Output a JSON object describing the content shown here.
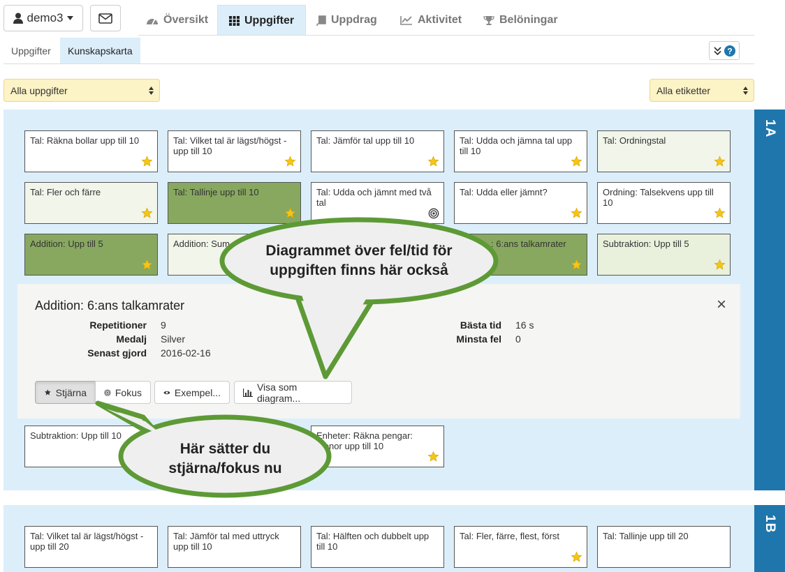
{
  "nav": {
    "user_label": "demo3",
    "tabs": [
      {
        "label": "Översikt",
        "icon": "dashboard-icon"
      },
      {
        "label": "Uppgifter",
        "icon": "grid-icon"
      },
      {
        "label": "Uppdrag",
        "icon": "book-icon"
      },
      {
        "label": "Aktivitet",
        "icon": "line-chart-icon"
      },
      {
        "label": "Belöningar",
        "icon": "trophy-icon"
      }
    ],
    "active_tab": "Uppgifter"
  },
  "subnav": {
    "tabs": [
      {
        "label": "Uppgifter"
      },
      {
        "label": "Kunskapskarta"
      }
    ],
    "active_tab": "Kunskapskarta"
  },
  "filters": {
    "tasks_select": "Alla uppgifter",
    "tags_select": "Alla etiketter"
  },
  "sections": [
    {
      "label": "1A"
    },
    {
      "label": "1B"
    }
  ],
  "cards_1a": [
    {
      "text": "Tal: Räkna bollar upp till 10",
      "mark": "star"
    },
    {
      "text": "Tal: Vilket tal är lägst/högst - upp till 10",
      "mark": "star"
    },
    {
      "text": "Tal: Jämför tal upp till 10",
      "mark": "star"
    },
    {
      "text": "Tal: Udda och jämna tal upp till 10",
      "mark": "star"
    },
    {
      "text": "Tal: Ordningstal",
      "mark": "star"
    },
    {
      "text": "Tal: Fler och färre",
      "mark": "star"
    },
    {
      "text": "Tal: Tallinje upp till 10",
      "mark": "star"
    },
    {
      "text": "Tal: Udda och jämnt med två tal",
      "mark": "target"
    },
    {
      "text": "Tal: Udda eller jämnt?",
      "mark": "star"
    },
    {
      "text": "Ordning: Talsekvens upp till 10",
      "mark": "star"
    },
    {
      "text": "Addition: Upp till 5",
      "mark": "star"
    },
    {
      "text": "Addition: Sum",
      "mark": ""
    },
    {
      "text": ": 6:ans talkamrater",
      "mark": "star"
    },
    {
      "text": "Subtraktion: Upp till 5",
      "mark": "star"
    },
    {
      "text": "Subtraktion: Upp till 10",
      "mark": ""
    },
    {
      "text": "Enheter: Räkna pengar: kronor upp till 10",
      "mark": "star"
    }
  ],
  "cards_1b": [
    {
      "text": "Tal: Vilket tal är lägst/högst - upp till 20"
    },
    {
      "text": "Tal: Jämför tal med uttryck upp till 10"
    },
    {
      "text": "Tal: Hälften och dubbelt upp till 10"
    },
    {
      "text": "Tal: Fler, färre, flest, först",
      "mark": "star"
    },
    {
      "text": "Tal: Tallinje upp till 20"
    }
  ],
  "detail": {
    "title": "Addition: 6:ans talkamrater",
    "fields": [
      {
        "label": "Repetitioner",
        "value": "9"
      },
      {
        "label": "Medalj",
        "value": "Silver"
      },
      {
        "label": "Senast gjord",
        "value": "2016-02-16"
      },
      {
        "label": "Bästa tid",
        "value": "16 s"
      },
      {
        "label": "Minsta fel",
        "value": "0"
      }
    ],
    "buttons": [
      {
        "label": "Stjärna",
        "icon": "star-icon"
      },
      {
        "label": "Fokus",
        "icon": "target-icon"
      },
      {
        "label": "Exempel...",
        "icon": "eye-icon"
      },
      {
        "label": "Visa som diagram...",
        "icon": "bar-chart-icon"
      }
    ],
    "close_label": "×"
  },
  "callouts": {
    "top": "Diagrammet över fel/tid för uppgiften finns här också",
    "bottom": "Här sätter du stjärna/fokus nu"
  },
  "colors": {
    "accent": "#1f76ad",
    "section_bg": "#dceefa",
    "done_green": "#88a860",
    "bubble_border": "#5d9a36",
    "star": "#f5c518"
  }
}
